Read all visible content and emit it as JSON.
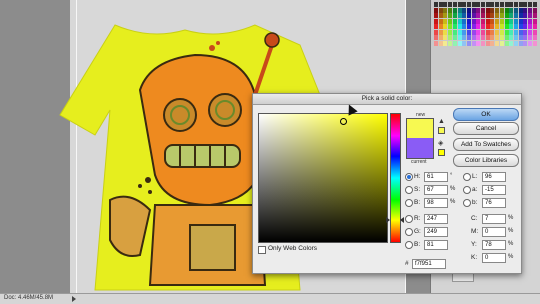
{
  "status_bar": {
    "doc_info": "Doc: 4.46M/45.8M"
  },
  "dialog": {
    "title": "Pick a solid color:",
    "new_label": "new",
    "current_label": "current",
    "new_color": "#f7f951",
    "current_color": "#8a5cf5",
    "buttons": {
      "ok": "OK",
      "cancel": "Cancel",
      "add_swatches": "Add To Swatches",
      "color_libraries": "Color Libraries"
    },
    "hsb": {
      "h": {
        "label": "H:",
        "value": "61",
        "unit": "°"
      },
      "s": {
        "label": "S:",
        "value": "67",
        "unit": "%"
      },
      "b": {
        "label": "B:",
        "value": "98",
        "unit": "%"
      }
    },
    "rgb": {
      "r": {
        "label": "R:",
        "value": "247"
      },
      "g": {
        "label": "G:",
        "value": "249"
      },
      "b": {
        "label": "B:",
        "value": "81"
      }
    },
    "lab": {
      "l": {
        "label": "L:",
        "value": "96"
      },
      "a": {
        "label": "a:",
        "value": "-15"
      },
      "b": {
        "label": "b:",
        "value": "76"
      }
    },
    "cmyk": {
      "c": {
        "label": "C:",
        "value": "7",
        "unit": "%"
      },
      "m": {
        "label": "M:",
        "value": "0",
        "unit": "%"
      },
      "y": {
        "label": "Y:",
        "value": "78",
        "unit": "%"
      },
      "k": {
        "label": "K:",
        "value": "0",
        "unit": "%"
      }
    },
    "only_web_colors": "Only Web Colors",
    "hex_label": "#",
    "hex_value": "f7f951"
  },
  "icons": [
    "warning-icon",
    "cube-icon",
    "cursor-icon"
  ]
}
